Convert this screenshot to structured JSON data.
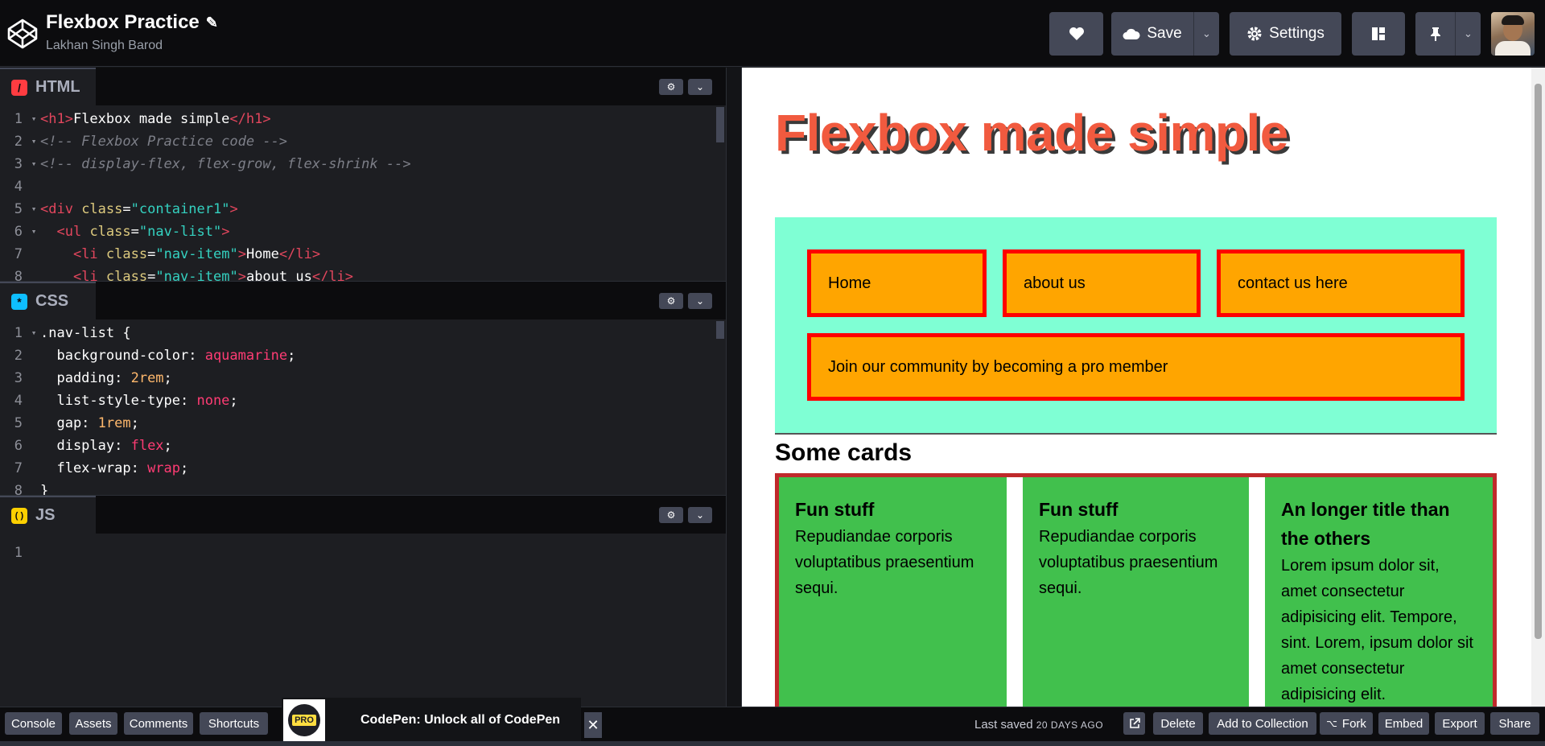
{
  "header": {
    "title": "Flexbox Practice",
    "author": "Lakhan Singh Barod",
    "buttons": {
      "save": "Save",
      "settings": "Settings"
    }
  },
  "editors": {
    "html": {
      "label": "HTML",
      "badge": "/",
      "badge_color": "#ff3c41",
      "lines": [
        {
          "n": "1",
          "fold": "▾",
          "segments": [
            [
              "t-tag",
              "<h1>"
            ],
            [
              "",
              "Flexbox made simple"
            ],
            [
              "t-tag",
              "</h1>"
            ]
          ]
        },
        {
          "n": "2",
          "fold": "▾",
          "segments": [
            [
              "t-com",
              "<!-- Flexbox Practice code -->"
            ]
          ]
        },
        {
          "n": "3",
          "fold": "▾",
          "segments": [
            [
              "t-com",
              "<!-- display-flex, flex-grow, flex-shrink -->"
            ]
          ]
        },
        {
          "n": "4",
          "fold": "",
          "segments": []
        },
        {
          "n": "5",
          "fold": "▾",
          "segments": [
            [
              "t-tag",
              "<div "
            ],
            [
              "t-attr",
              "class"
            ],
            [
              "",
              "="
            ],
            [
              "t-str",
              "\"container1\""
            ],
            [
              "t-tag",
              ">"
            ]
          ]
        },
        {
          "n": "6",
          "fold": "▾",
          "segments": [
            [
              "",
              "  "
            ],
            [
              "t-tag",
              "<ul "
            ],
            [
              "t-attr",
              "class"
            ],
            [
              "",
              "="
            ],
            [
              "t-str",
              "\"nav-list\""
            ],
            [
              "t-tag",
              ">"
            ]
          ]
        },
        {
          "n": "7",
          "fold": "",
          "segments": [
            [
              "",
              "    "
            ],
            [
              "t-tag",
              "<li "
            ],
            [
              "t-attr",
              "class"
            ],
            [
              "",
              "="
            ],
            [
              "t-str",
              "\"nav-item\""
            ],
            [
              "t-tag",
              ">"
            ],
            [
              "",
              "Home"
            ],
            [
              "t-tag",
              "</li>"
            ]
          ]
        },
        {
          "n": "8",
          "fold": "",
          "segments": [
            [
              "",
              "    "
            ],
            [
              "t-tag",
              "<li "
            ],
            [
              "t-attr",
              "class"
            ],
            [
              "",
              "="
            ],
            [
              "t-str",
              "\"nav-item\""
            ],
            [
              "t-tag",
              ">"
            ],
            [
              "",
              "about us"
            ],
            [
              "t-tag",
              "</li>"
            ]
          ]
        }
      ]
    },
    "css": {
      "label": "CSS",
      "badge": "*",
      "badge_color": "#0ebeff",
      "lines": [
        {
          "n": "1",
          "fold": "▾",
          "segments": [
            [
              "",
              ".nav-list {"
            ]
          ]
        },
        {
          "n": "2",
          "fold": "",
          "segments": [
            [
              "",
              "  background-color: "
            ],
            [
              "t-kw",
              "aquamarine"
            ],
            [
              "",
              ";"
            ]
          ]
        },
        {
          "n": "3",
          "fold": "",
          "segments": [
            [
              "",
              "  padding: "
            ],
            [
              "t-num",
              "2rem"
            ],
            [
              "",
              ";"
            ]
          ]
        },
        {
          "n": "4",
          "fold": "",
          "segments": [
            [
              "",
              "  list-style-type: "
            ],
            [
              "t-kw",
              "none"
            ],
            [
              "",
              ";"
            ]
          ]
        },
        {
          "n": "5",
          "fold": "",
          "segments": [
            [
              "",
              "  gap: "
            ],
            [
              "t-num",
              "1rem"
            ],
            [
              "",
              ";"
            ]
          ]
        },
        {
          "n": "6",
          "fold": "",
          "segments": [
            [
              "",
              "  display: "
            ],
            [
              "t-kw",
              "flex"
            ],
            [
              "",
              ";"
            ]
          ]
        },
        {
          "n": "7",
          "fold": "",
          "segments": [
            [
              "",
              "  flex-wrap: "
            ],
            [
              "t-kw",
              "wrap"
            ],
            [
              "",
              ";"
            ]
          ]
        },
        {
          "n": "8",
          "fold": "",
          "segments": [
            [
              "",
              "}"
            ]
          ]
        }
      ]
    },
    "js": {
      "label": "JS",
      "badge": "( )",
      "badge_color": "#fcd000",
      "lines": [
        {
          "n": "1",
          "fold": "",
          "segments": []
        }
      ]
    }
  },
  "preview": {
    "h1": "Flexbox made simple",
    "nav": [
      "Home",
      "about us",
      "contact us here",
      "Join our community by becoming a pro member"
    ],
    "h2": "Some cards",
    "cards": [
      {
        "title": "Fun stuff",
        "text": "Repudiandae corporis voluptatibus praesentium sequi."
      },
      {
        "title": "Fun stuff",
        "text": "Repudiandae corporis voluptatibus praesentium sequi."
      },
      {
        "title": "An longer title than the others",
        "text": "Lorem ipsum dolor sit, amet consectetur adipisicing elit. Tempore, sint. Lorem, ipsum dolor sit amet consectetur adipisicing elit."
      }
    ]
  },
  "footer": {
    "left_buttons": [
      "Console",
      "Assets",
      "Comments",
      "Shortcuts"
    ],
    "promo": {
      "badge": "PRO",
      "text": "CodePen: Unlock all of CodePen"
    },
    "saved_prefix": "Last saved",
    "saved_ago": "20 DAYS AGO",
    "right_buttons": {
      "delete": "Delete",
      "add_to_collection": "Add to Collection",
      "fork": "Fork",
      "embed": "Embed",
      "export": "Export",
      "share": "Share"
    }
  }
}
